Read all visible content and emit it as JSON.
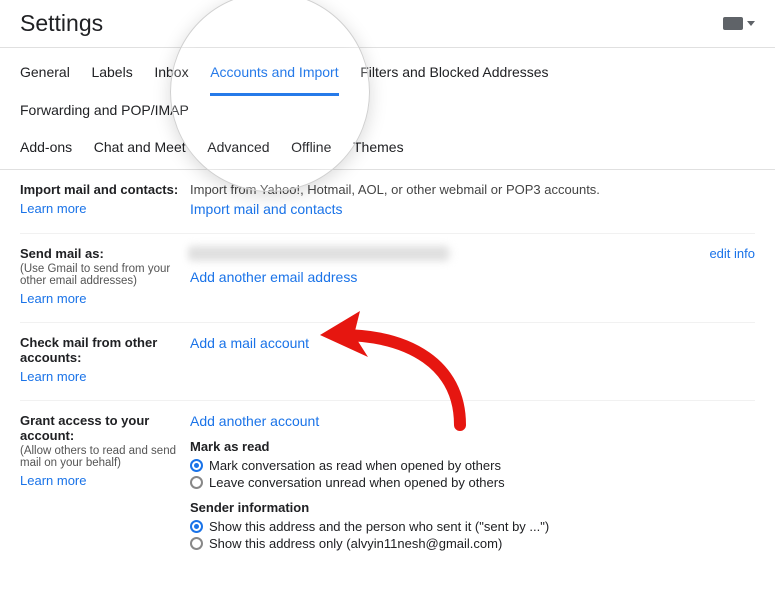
{
  "header": {
    "title": "Settings"
  },
  "tabs": {
    "row1": [
      "General",
      "Labels",
      "Inbox",
      "Accounts and Import",
      "Filters and Blocked Addresses",
      "Forwarding and POP/IMAP"
    ],
    "row2": [
      "Add-ons",
      "Chat and Meet",
      "Advanced",
      "Offline",
      "Themes"
    ],
    "active": "Accounts and Import"
  },
  "sections": {
    "import": {
      "title": "Import mail and contacts:",
      "learn": "Learn more",
      "desc": "Import from Yahoo!, Hotmail, AOL, or other webmail or POP3 accounts.",
      "action": "Import mail and contacts"
    },
    "sendas": {
      "title": "Send mail as:",
      "sub": "(Use Gmail to send from your other email addresses)",
      "learn": "Learn more",
      "action": "Add another email address",
      "edit": "edit info"
    },
    "check": {
      "title": "Check mail from other accounts:",
      "learn": "Learn more",
      "action": "Add a mail account"
    },
    "grant": {
      "title": "Grant access to your account:",
      "sub": "(Allow others to read and send mail on your behalf)",
      "learn": "Learn more",
      "action": "Add another account",
      "markRead": {
        "heading": "Mark as read",
        "opt1": "Mark conversation as read when opened by others",
        "opt2": "Leave conversation unread when opened by others"
      },
      "sender": {
        "heading": "Sender information",
        "opt1": "Show this address and the person who sent it (\"sent by ...\")",
        "opt2": "Show this address only (alvyin11nesh@gmail.com)"
      }
    }
  }
}
